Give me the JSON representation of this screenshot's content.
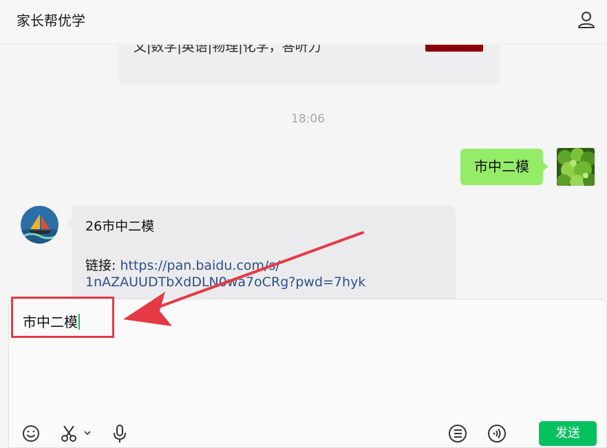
{
  "header": {
    "title": "家长帮优学",
    "user_icon": "user-icon"
  },
  "chat": {
    "clipped_card_text": "文|数学|英语|物理|化学，答听力",
    "timestamp": "18:06",
    "outgoing_message": "市中二模",
    "incoming": {
      "line1": "26市中二模",
      "link_label": "链接: ",
      "link_part1": "https://pan.baidu.com/s/",
      "link_part2": "1nAZAUUDTbXdDLN0wa7oCRg?pwd=7hyk"
    }
  },
  "composer": {
    "input_value": "市中二模",
    "tools": [
      "emoji-icon",
      "scissors-icon",
      "microphone-icon",
      "chat-history-icon",
      "voice-call-icon"
    ],
    "send_label": "发送"
  },
  "colors": {
    "send": "#07c160",
    "bubble_out": "#95ec69",
    "annotation": "#e53a44",
    "link": "#2b4f8c"
  }
}
